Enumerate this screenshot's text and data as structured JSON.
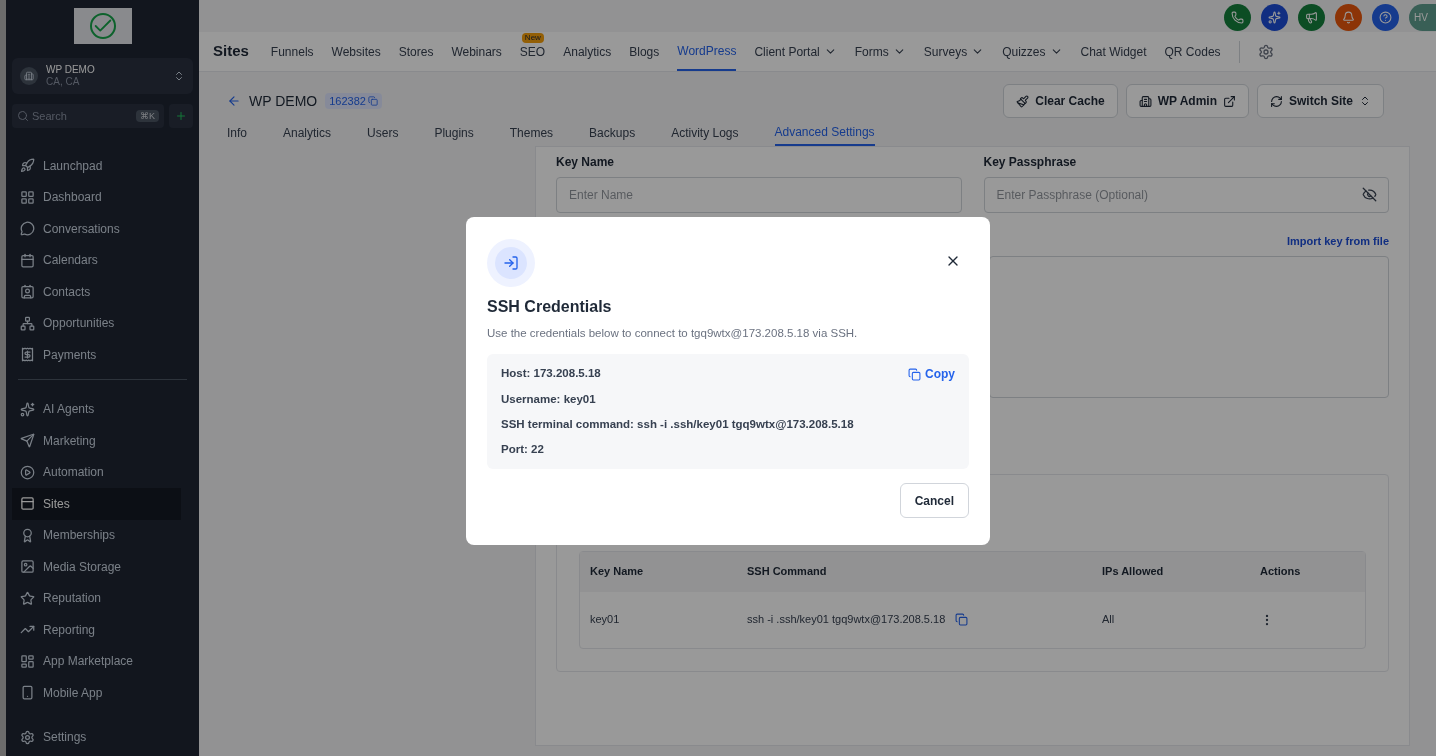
{
  "sidebar": {
    "account": {
      "name": "WP DEMO",
      "location": "CA, CA"
    },
    "search": {
      "placeholder": "Search",
      "shortcut": "⌘K"
    },
    "groups": [
      [
        {
          "label": "Launchpad",
          "selected": false
        },
        {
          "label": "Dashboard",
          "selected": false
        },
        {
          "label": "Conversations",
          "selected": false
        },
        {
          "label": "Calendars",
          "selected": false
        },
        {
          "label": "Contacts",
          "selected": false
        },
        {
          "label": "Opportunities",
          "selected": false
        },
        {
          "label": "Payments",
          "selected": false
        }
      ],
      [
        {
          "label": "AI Agents",
          "selected": false
        },
        {
          "label": "Marketing",
          "selected": false
        },
        {
          "label": "Automation",
          "selected": false
        },
        {
          "label": "Sites",
          "selected": true
        },
        {
          "label": "Memberships",
          "selected": false
        },
        {
          "label": "Media Storage",
          "selected": false
        },
        {
          "label": "Reputation",
          "selected": false
        },
        {
          "label": "Reporting",
          "selected": false
        },
        {
          "label": "App Marketplace",
          "selected": false
        },
        {
          "label": "Mobile App",
          "selected": false
        }
      ]
    ],
    "footer": {
      "label": "Settings"
    }
  },
  "header": {
    "avatar": "HV"
  },
  "topnav": {
    "title": "Sites",
    "items": [
      {
        "label": "Funnels",
        "selected": false,
        "dropdown": false
      },
      {
        "label": "Websites",
        "selected": false,
        "dropdown": false
      },
      {
        "label": "Stores",
        "selected": false,
        "dropdown": false
      },
      {
        "label": "Webinars",
        "selected": false,
        "dropdown": false
      },
      {
        "label": "SEO",
        "selected": false,
        "dropdown": false,
        "badge": "New"
      },
      {
        "label": "Analytics",
        "selected": false,
        "dropdown": false
      },
      {
        "label": "Blogs",
        "selected": false,
        "dropdown": false
      },
      {
        "label": "WordPress",
        "selected": true,
        "dropdown": false
      },
      {
        "label": "Client Portal",
        "selected": false,
        "dropdown": true
      },
      {
        "label": "Forms",
        "selected": false,
        "dropdown": true
      },
      {
        "label": "Surveys",
        "selected": false,
        "dropdown": true
      },
      {
        "label": "Quizzes",
        "selected": false,
        "dropdown": true
      },
      {
        "label": "Chat Widget",
        "selected": false,
        "dropdown": false
      },
      {
        "label": "QR Codes",
        "selected": false,
        "dropdown": false
      }
    ]
  },
  "site": {
    "title": "WP DEMO",
    "id": "162382",
    "buttons": [
      "Clear Cache",
      "WP Admin",
      "Switch Site"
    ],
    "tabs": [
      {
        "label": "Info",
        "selected": false
      },
      {
        "label": "Analytics",
        "selected": false
      },
      {
        "label": "Users",
        "selected": false
      },
      {
        "label": "Plugins",
        "selected": false
      },
      {
        "label": "Themes",
        "selected": false
      },
      {
        "label": "Backups",
        "selected": false
      },
      {
        "label": "Activity Logs",
        "selected": false
      },
      {
        "label": "Advanced Settings",
        "selected": true
      }
    ]
  },
  "form": {
    "key_name": {
      "label": "Key Name",
      "placeholder": "Enter Name"
    },
    "passphrase": {
      "label": "Key Passphrase",
      "placeholder": "Enter Passphrase (Optional)"
    },
    "import_link": "Import key from file"
  },
  "table": {
    "columns": [
      "Key Name",
      "SSH Command",
      "IPs Allowed",
      "Actions"
    ],
    "rows": [
      {
        "key_name": "key01",
        "command": "ssh -i .ssh/key01 tgq9wtx@173.208.5.18",
        "ips": "All"
      }
    ]
  },
  "modal": {
    "title": "SSH Credentials",
    "description": "Use the credentials below to connect to tgq9wtx@173.208.5.18 via SSH.",
    "lines": [
      "Host: 173.208.5.18",
      "Username: key01",
      "SSH terminal command: ssh -i .ssh/key01 tgq9wtx@173.208.5.18",
      "Port: 22"
    ],
    "copy": "Copy",
    "cancel": "Cancel"
  }
}
